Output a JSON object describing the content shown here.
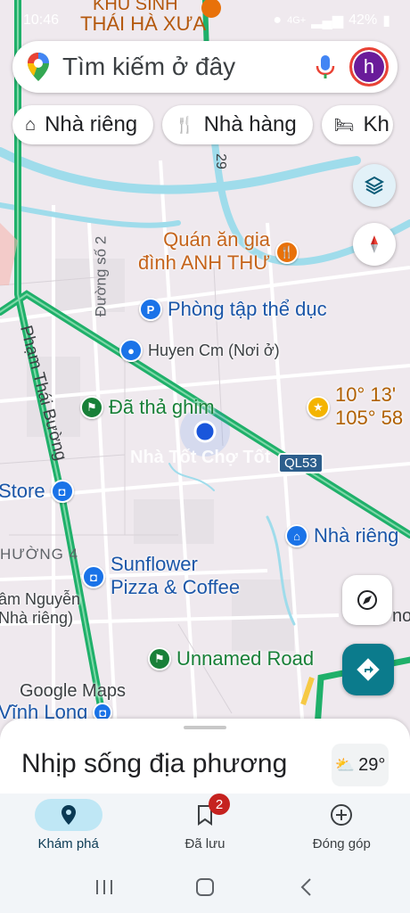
{
  "status_bar": {
    "time": "10:46",
    "network": "4G+",
    "battery": "42%"
  },
  "search": {
    "placeholder": "Tìm kiếm ở đây",
    "avatar_letter": "h"
  },
  "chips": [
    {
      "icon": "home-icon",
      "label": "Nhà riêng"
    },
    {
      "icon": "restaurant-icon",
      "label": "Nhà hàng"
    },
    {
      "icon": "hotel-icon",
      "label": "Kh"
    }
  ],
  "map": {
    "top_label": "THÁI HÀ XƯA",
    "top_label_2": "KHU SINH",
    "road_29": "29",
    "street_duong_so_2": "Đường số 2",
    "street_pham_thai_buong": "Phạm Thái Bường",
    "route_badge": "QL53",
    "ward_label": "HƯỜNG 4",
    "partial_label_bottom_right": "no",
    "pois": {
      "restaurant": {
        "line1": "Quán ăn gia",
        "line2": "đình ANH THƯ"
      },
      "gym": "Phòng tập thể dục",
      "home_huyen": "Huyen Cm (Nơi ở)",
      "dropped_pin": "Đã thả ghim",
      "coordinate_line1": "10° 13'",
      "coordinate_line2": "105° 58",
      "store": "Store",
      "home_right": "Nhà riêng",
      "sunflower_line1": "Sunflower",
      "sunflower_line2": "Pizza & Coffee",
      "lam_nguyen_line1": "âm Nguyễn",
      "lam_nguyen_line2": "Nhà riêng)",
      "unnamed_road": "Unnamed Road",
      "vinh_long": "Vĩnh Long"
    },
    "watermark": "Nhà Tốt Chợ Tốt",
    "logo": "Google Maps"
  },
  "bottom_sheet": {
    "title": "Nhịp sống địa phương",
    "weather": "29°"
  },
  "bottom_nav": [
    {
      "label": "Khám phá",
      "icon": "explore-pin-icon",
      "active": true
    },
    {
      "label": "Đã lưu",
      "icon": "bookmark-icon",
      "badge": "2"
    },
    {
      "label": "Đóng góp",
      "icon": "add-circle-icon"
    }
  ],
  "colors": {
    "road_green": "#1fb06a",
    "accent_blue": "#1a73e8",
    "poi_green": "#188038",
    "poi_orange": "#e8710a",
    "poi_text_orange": "#c5641b",
    "teal": "#0b7b8c"
  }
}
